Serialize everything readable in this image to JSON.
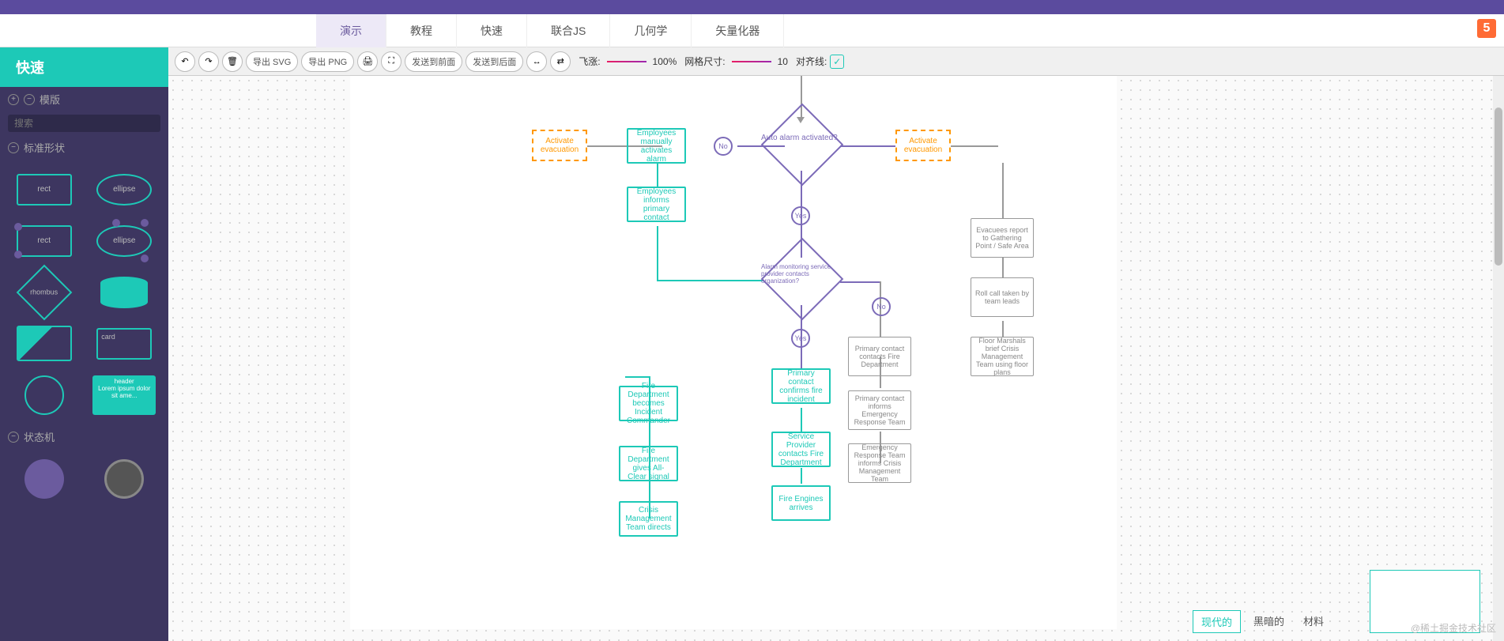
{
  "nav": {
    "tabs": [
      "演示",
      "教程",
      "快速",
      "联合JS",
      "几何学",
      "矢量化器"
    ],
    "active": 0
  },
  "sidebar": {
    "title": "快速",
    "sections": {
      "templates": "模版",
      "standard": "标准形状",
      "state": "状态机"
    },
    "search_placeholder": "搜索",
    "shapes": {
      "rect": "rect",
      "ellipse": "ellipse",
      "rhombus": "rhombus",
      "card": "card",
      "header": "header",
      "lorem": "Lorem ipsum dolor sit ame...",
      "state": "state"
    }
  },
  "toolbar": {
    "export_svg": "导出 SVG",
    "export_png": "导出 PNG",
    "send_front": "发送到前面",
    "send_back": "发送到后面",
    "zoom_label": "飞涨:",
    "zoom_val": "100%",
    "grid_label": "网格尺寸:",
    "grid_val": "10",
    "snap_label": "对齐线:"
  },
  "flowchart": {
    "nodes": {
      "auto_alarm": "Auto alarm activated?",
      "activate_evac_l": "Activate evacuation",
      "activate_evac_r": "Activate evacuation",
      "emp_manual": "Employees manually activates alarm",
      "emp_inform": "Employees informs primary contact",
      "alarm_monitor": "Alarm monitoring service provider contacts organization?",
      "primary_confirm": "Primary contact confirms fire incident",
      "service_provider": "Service Provider contacts Fire Department",
      "fire_arrives": "Fire Engines arrives",
      "primary_fire": "Primary contact contacts Fire Department",
      "primary_ert": "Primary contact informs Emergency Response Team",
      "ert_crisis": "Emergency Response Team informs Crisis Management Team",
      "evacuees": "Evacuees report to Gathering Point / Safe Area",
      "rollcall": "Roll call taken by team leads",
      "marshals": "Floor Marshals brief Crisis Management Team using floor plans",
      "fire_cmd": "Fire Department becomes Incident Commander",
      "fire_clear": "Fire Department gives All-Clear signal",
      "crisis_mgmt": "Crisis Management Team directs"
    },
    "labels": {
      "yes": "Yes",
      "no": "No"
    }
  },
  "bottom": {
    "modern": "现代的",
    "dark": "黑暗的",
    "material": "材料"
  },
  "watermark": "@稀土掘金技术社区"
}
